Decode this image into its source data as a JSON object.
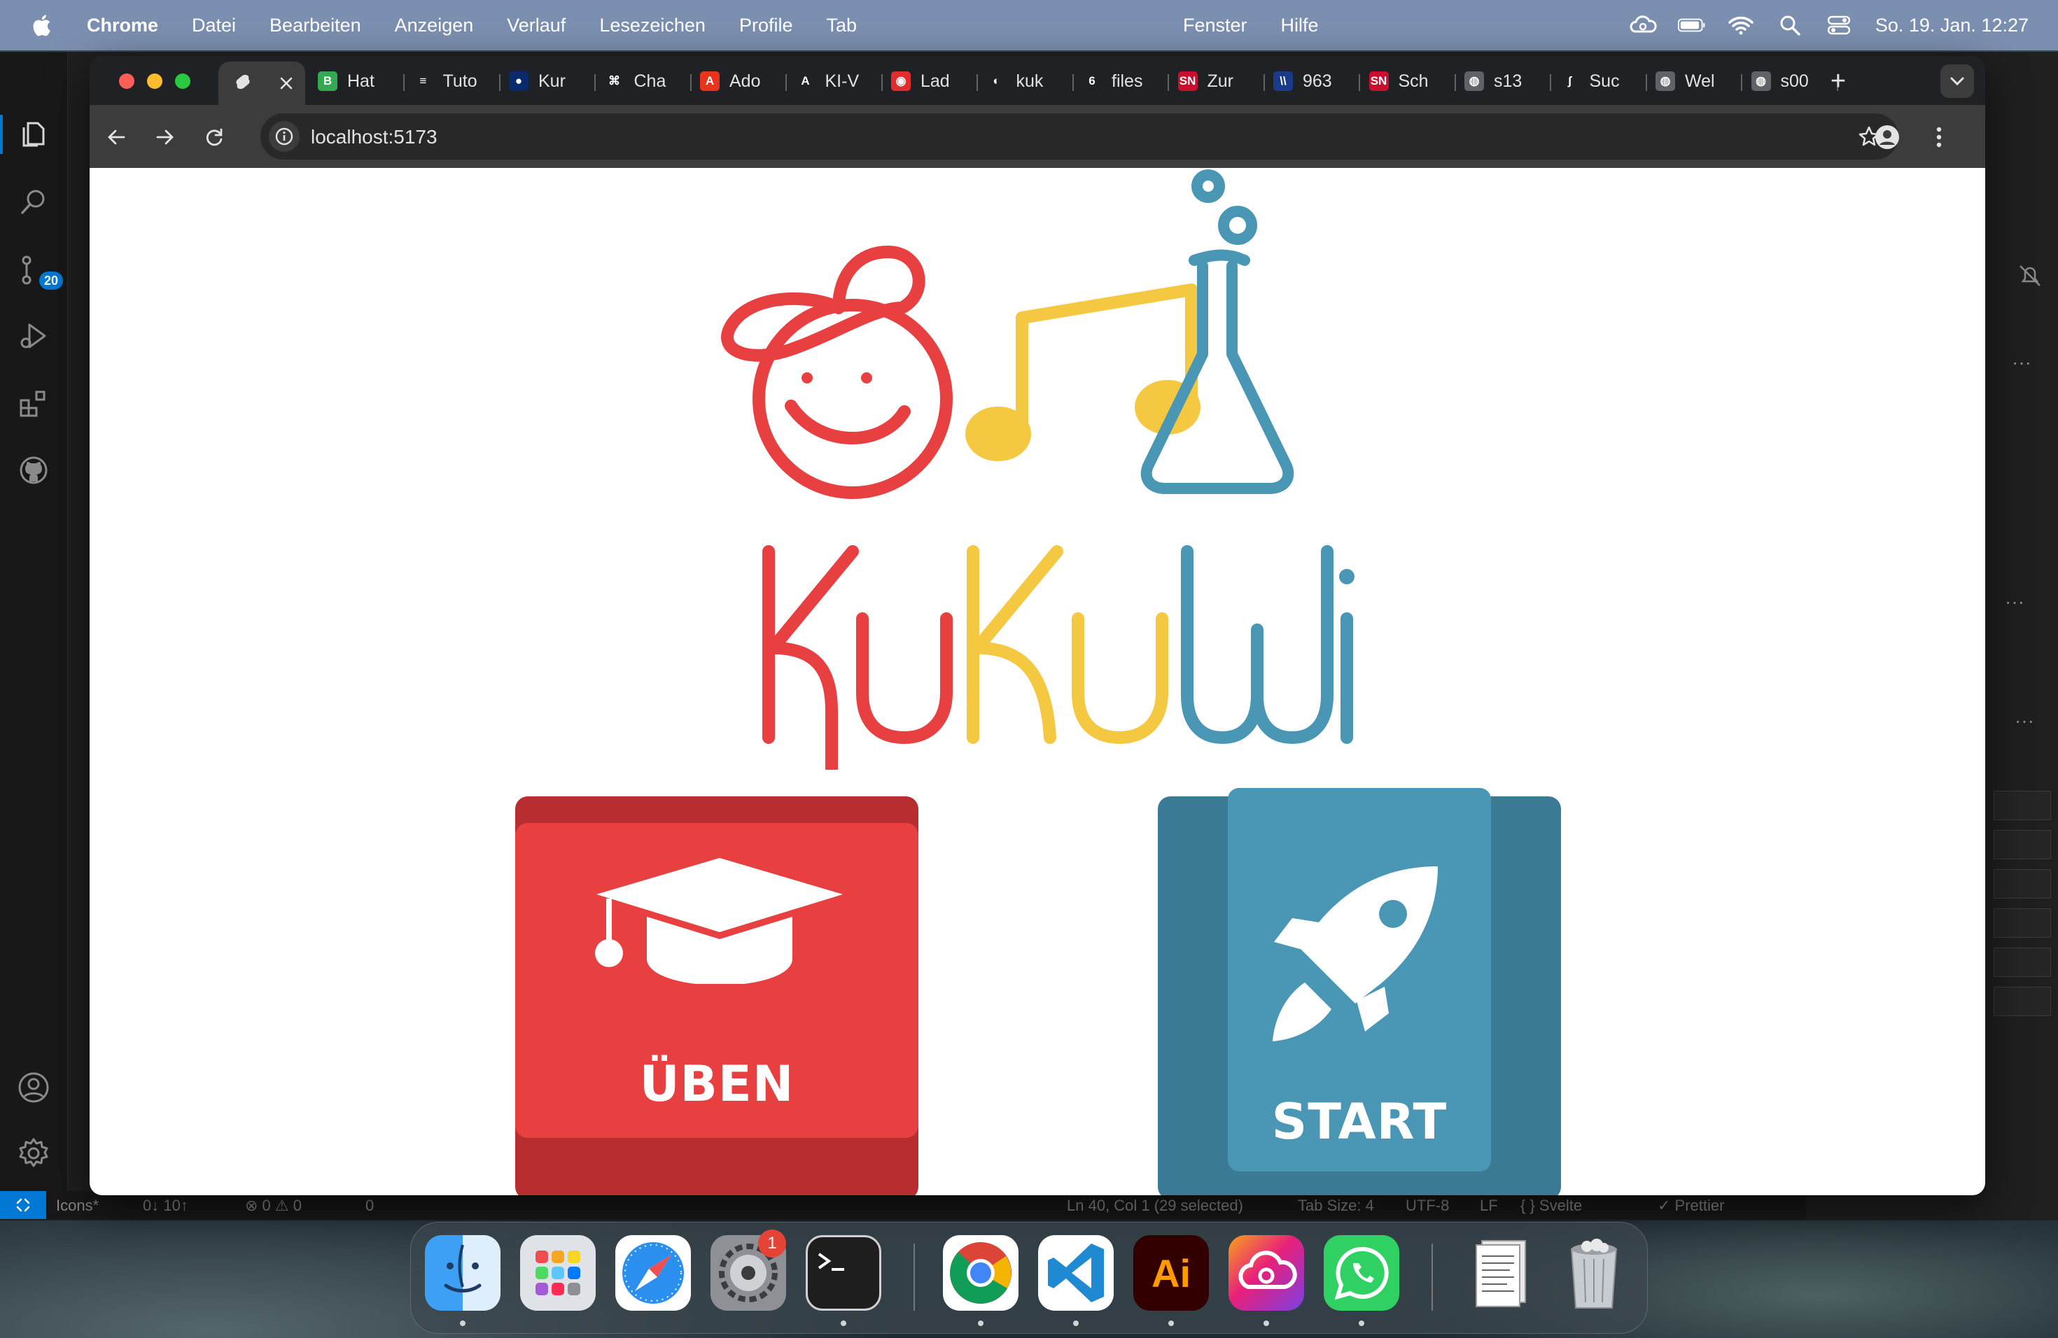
{
  "menubar": {
    "app": "Chrome",
    "items": [
      "Datei",
      "Bearbeiten",
      "Anzeigen",
      "Verlauf",
      "Lesezeichen",
      "Profile",
      "Tab"
    ],
    "items_right": [
      "Fenster",
      "Hilfe"
    ],
    "clock": "So. 19. Jan.  12:27"
  },
  "vscode": {
    "scm_badge": "20",
    "status": {
      "branch": "Icons*",
      "sync": "0↓ 10↑",
      "problems": "⊗ 0 ⚠ 0",
      "ports": "0",
      "cursor": "Ln 40, Col 1 (29 selected)",
      "tab_size": "Tab Size: 4",
      "encoding": "UTF-8",
      "eol": "LF",
      "language": "{ } Svelte",
      "prettier": "✓ Prettier"
    }
  },
  "chrome": {
    "tabs": [
      {
        "label": "Hat",
        "color": "#34a853",
        "glyph": "B"
      },
      {
        "label": "Tuto",
        "color": "#202124",
        "glyph": "≡"
      },
      {
        "label": "Kur",
        "color": "#0b2a6b",
        "glyph": "●"
      },
      {
        "label": "Cha",
        "color": "#202124",
        "glyph": "⌘"
      },
      {
        "label": "Ado",
        "color": "#e8341c",
        "glyph": "A"
      },
      {
        "label": "KI-V",
        "color": "#202124",
        "glyph": "A"
      },
      {
        "label": "Lad",
        "color": "#e02e2e",
        "glyph": "◉"
      },
      {
        "label": "kuk",
        "color": "#202124",
        "glyph": "◐"
      },
      {
        "label": "files",
        "color": "#202124",
        "glyph": "6"
      },
      {
        "label": "Zur",
        "color": "#c8102e",
        "glyph": "SN"
      },
      {
        "label": "963",
        "color": "#1a3a8a",
        "glyph": "\\\\"
      },
      {
        "label": "Sch",
        "color": "#c8102e",
        "glyph": "SN"
      },
      {
        "label": "s13",
        "color": "#5f6368",
        "glyph": "◍"
      },
      {
        "label": "Suc",
        "color": "#202124",
        "glyph": "ʃ"
      },
      {
        "label": "Wel",
        "color": "#5f6368",
        "glyph": "◍"
      },
      {
        "label": "s00",
        "color": "#5f6368",
        "glyph": "◍"
      }
    ],
    "url": "localhost:5173"
  },
  "page": {
    "logo_parts": [
      "Ku",
      "Ku",
      "Wi"
    ],
    "buttons": {
      "uben": "ÜBEN",
      "start": "START"
    }
  },
  "colors": {
    "red": "#e84040",
    "yellow": "#f5c842",
    "blue": "#4a96b5"
  },
  "dock": {
    "apps": [
      "finder-icon",
      "launchpad-icon",
      "safari-icon",
      "system-settings-icon",
      "terminal-icon",
      "chrome-icon",
      "vscode-icon",
      "illustrator-icon",
      "creative-cloud-icon",
      "whatsapp-icon",
      "document-icon",
      "trash-icon"
    ],
    "settings_badge": "1",
    "illustrator_label": "Ai"
  }
}
